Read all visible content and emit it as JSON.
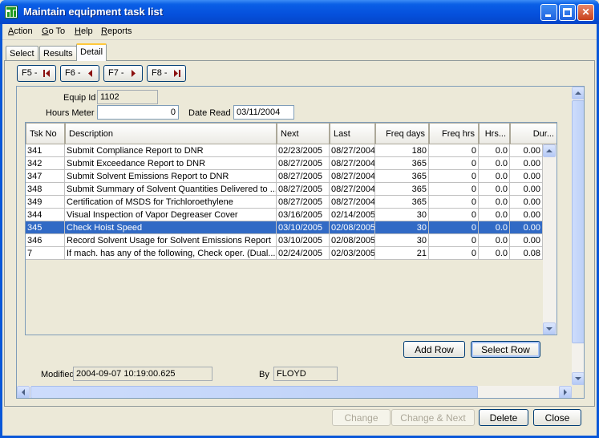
{
  "window": {
    "title": "Maintain equipment task list"
  },
  "menu": [
    {
      "label": "Action",
      "u": "A",
      "rest": "ction"
    },
    {
      "label": "Go To",
      "u": "G",
      "rest": "o To"
    },
    {
      "label": "Help",
      "u": "H",
      "rest": "elp"
    },
    {
      "label": "Reports",
      "u": "R",
      "rest": "eports"
    }
  ],
  "tabs": [
    "Select",
    "Results",
    "Detail"
  ],
  "nav": {
    "first": "F5 -",
    "prev": "F6 -",
    "next": "F7 -",
    "last": "F8 -"
  },
  "form": {
    "equip_id_label": "Equip Id",
    "equip_id": "1102",
    "hours_meter_label": "Hours Meter",
    "hours_meter": "0",
    "date_read_label": "Date Read",
    "date_read": "03/11/2004",
    "modified_label": "Modified",
    "modified": "2004-09-07 10:19:00.625",
    "by_label": "By",
    "by": "FLOYD"
  },
  "table": {
    "headers": [
      "Tsk No",
      "Description",
      "Next",
      "Last",
      "Freq days",
      "Freq hrs",
      "Hrs...",
      "Dur..."
    ],
    "rows": [
      [
        "341",
        "Submit Compliance Report to DNR",
        "02/23/2005",
        "08/27/2004",
        "180",
        "0",
        "0.0",
        "0.00"
      ],
      [
        "342",
        "Submit Exceedance Report to DNR",
        "08/27/2005",
        "08/27/2004",
        "365",
        "0",
        "0.0",
        "0.00"
      ],
      [
        "347",
        "Submit Solvent Emissions Report to DNR",
        "08/27/2005",
        "08/27/2004",
        "365",
        "0",
        "0.0",
        "0.00"
      ],
      [
        "348",
        "Submit Summary of Solvent Quantities Delivered to ...",
        "08/27/2005",
        "08/27/2004",
        "365",
        "0",
        "0.0",
        "0.00"
      ],
      [
        "349",
        "Certification of MSDS for Trichloroethylene",
        "08/27/2005",
        "08/27/2004",
        "365",
        "0",
        "0.0",
        "0.00"
      ],
      [
        "344",
        "Visual Inspection of Vapor Degreaser Cover",
        "03/16/2005",
        "02/14/2005",
        "30",
        "0",
        "0.0",
        "0.00"
      ],
      [
        "345",
        "Check Hoist Speed",
        "03/10/2005",
        "02/08/2005",
        "30",
        "0",
        "0.0",
        "0.00"
      ],
      [
        "346",
        "Record Solvent Usage for Solvent Emissions Report",
        "03/10/2005",
        "02/08/2005",
        "30",
        "0",
        "0.0",
        "0.00"
      ],
      [
        "7",
        "If mach. has any of the following, Check oper. (Dual...",
        "02/24/2005",
        "02/03/2005",
        "21",
        "0",
        "0.0",
        "0.08"
      ]
    ],
    "selected_row": 6
  },
  "buttons": {
    "add_row": "Add Row",
    "select_row": "Select Row",
    "change": "Change",
    "change_next": "Change & Next",
    "delete": "Delete",
    "close": "Close"
  }
}
